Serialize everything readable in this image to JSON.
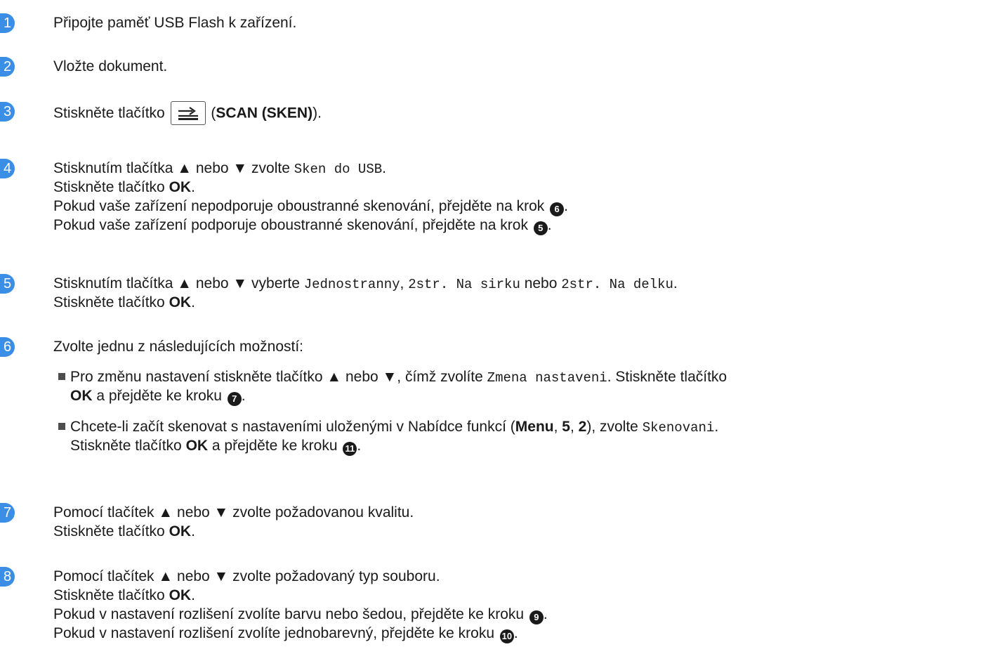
{
  "steps": [
    {
      "num": "1",
      "lines": [
        {
          "t": "Připojte paměť USB Flash k zařízení."
        }
      ]
    },
    {
      "num": "2",
      "lines": [
        {
          "t": "Vložte dokument."
        }
      ]
    },
    {
      "num": "3",
      "before": "Stiskněte tlačítko ",
      "after_open": "(",
      "bold": "SCAN (SKEN)",
      "after_close": ")."
    },
    {
      "num": "4",
      "l1_a": "Stisknutím tlačítka ▲ nebo ▼ zvolte ",
      "l1_mono": "Sken do USB",
      "l1_b": ".",
      "l2_a": "Stiskněte tlačítko ",
      "l2_bold": "OK",
      "l2_b": ".",
      "l3_a": "Pokud vaše zařízení nepodporuje oboustranné skenování, přejděte na krok ",
      "l3_ref": "6",
      "l3_b": ".",
      "l4_a": "Pokud vaše zařízení podporuje oboustranné skenování, přejděte na krok ",
      "l4_ref": "5",
      "l4_b": "."
    },
    {
      "num": "5",
      "l1_a": "Stisknutím tlačítka ▲ nebo ▼ vyberte ",
      "l1_m1": "Jednostranny",
      "l1_sep": ", ",
      "l1_m2": "2str. Na sirku",
      "l1_nebo": " nebo ",
      "l1_m3": "2str. Na delku",
      "l1_b": ".",
      "l2_a": "Stiskněte tlačítko ",
      "l2_bold": "OK",
      "l2_b": "."
    },
    {
      "num": "6",
      "intro": "Zvolte jednu z následujících možností:",
      "b1_a": "Pro změnu nastavení stiskněte tlačítko ▲ nebo ▼, čímž zvolíte ",
      "b1_mono": "Zmena nastaveni",
      "b1_b": ". Stiskněte tlačítko",
      "b1_c_bold": "OK",
      "b1_c": " a přejděte ke kroku ",
      "b1_ref": "7",
      "b1_d": ".",
      "b2_a": "Chcete-li začít skenovat s nastaveními uloženými v Nabídce funkcí (",
      "b2_menu": "Menu",
      "b2_comma1": ", ",
      "b2_5": "5",
      "b2_comma2": ", ",
      "b2_2": "2",
      "b2_close": "), zvolte ",
      "b2_mono": "Skenovani",
      "b2_dot": ".",
      "b2_l2_a": "Stiskněte tlačítko ",
      "b2_l2_bold": "OK",
      "b2_l2_b": " a přejděte ke kroku ",
      "b2_ref": "11",
      "b2_l2_c": "."
    },
    {
      "num": "7",
      "l1": "Pomocí tlačítek ▲ nebo ▼ zvolte požadovanou kvalitu.",
      "l2_a": "Stiskněte tlačítko ",
      "l2_bold": "OK",
      "l2_b": "."
    },
    {
      "num": "8",
      "l1": "Pomocí tlačítek ▲ nebo ▼ zvolte požadovaný typ souboru.",
      "l2_a": "Stiskněte tlačítko ",
      "l2_bold": "OK",
      "l2_b": ".",
      "l3_a": "Pokud v nastavení rozlišení zvolíte barvu nebo šedou, přejděte ke kroku ",
      "l3_ref": "9",
      "l3_b": ".",
      "l4_a": "Pokud v nastavení rozlišení zvolíte jednobarevný, přejděte ke kroku ",
      "l4_ref": "10",
      "l4_b": "."
    }
  ],
  "icons": {
    "scan_key": "scan-key-icon"
  },
  "colors": {
    "badge": "#3a8ee6",
    "text": "#1a1a1a"
  }
}
